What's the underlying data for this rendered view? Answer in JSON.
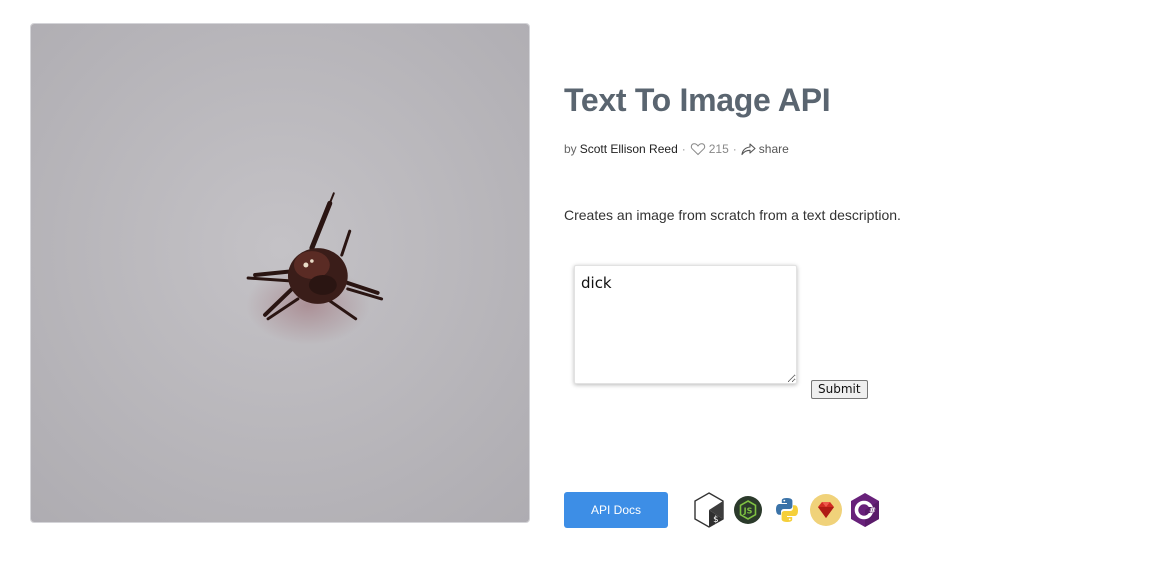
{
  "page": {
    "title": "Text To Image API",
    "byline_prefix": "by",
    "author": "Scott Ellison Reed",
    "likes": "215",
    "share_label": "share",
    "description": "Creates an image from scratch from a text description."
  },
  "form": {
    "prompt_value": "dick",
    "submit_label": "Submit"
  },
  "footer": {
    "api_docs_label": "API Docs",
    "languages": [
      "bash-icon",
      "nodejs-icon",
      "python-icon",
      "ruby-icon",
      "csharp-icon"
    ]
  },
  "colors": {
    "title": "#5a6570",
    "button_primary": "#3d8ee6",
    "image_background": "#b9b6bb"
  }
}
